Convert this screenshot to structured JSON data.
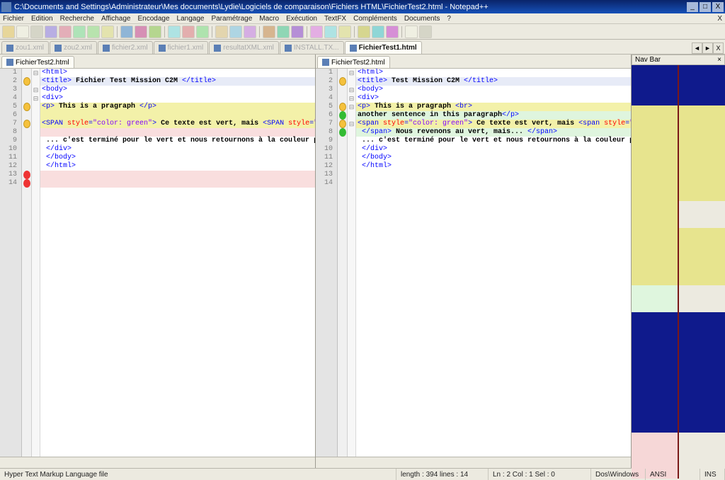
{
  "window": {
    "title": "C:\\Documents and Settings\\Administrateur\\Mes documents\\Lydie\\Logiciels de comparaison\\Fichiers HTML\\FichierTest2.html - Notepad++",
    "btn_min": "_",
    "btn_max": "□",
    "btn_close": "X"
  },
  "menu": {
    "items": [
      "Fichier",
      "Edition",
      "Recherche",
      "Affichage",
      "Encodage",
      "Langage",
      "Paramétrage",
      "Macro",
      "Exécution",
      "TextFX",
      "Compléments",
      "Documents",
      "?"
    ],
    "close_x": "X"
  },
  "tabs": {
    "items": [
      {
        "label": "zou1.xml",
        "state": "disabled"
      },
      {
        "label": "zou2.xml",
        "state": "disabled"
      },
      {
        "label": "fichier2.xml",
        "state": "disabled"
      },
      {
        "label": "fichier1.xml",
        "state": "disabled"
      },
      {
        "label": "resultatXML.xml",
        "state": "disabled"
      },
      {
        "label": "INSTALL.TX...",
        "state": "disabled"
      },
      {
        "label": "FichierTest1.html",
        "state": "active"
      }
    ],
    "nav_left": "◄",
    "nav_right": "►",
    "nav_x": "X"
  },
  "left_pane": {
    "tab": "FichierTest2.html",
    "lines": [
      {
        "n": 1,
        "mark": "",
        "fold": "⊟",
        "hl": "",
        "tokens": [
          [
            "t",
            "<html>"
          ]
        ]
      },
      {
        "n": 2,
        "mark": "warn",
        "fold": "",
        "hl": "b",
        "tokens": [
          [
            "t",
            "<title>"
          ],
          [
            "b",
            " Fichier Test Mission C2M "
          ],
          [
            "t",
            "</title>"
          ]
        ]
      },
      {
        "n": 3,
        "mark": "",
        "fold": "⊟",
        "hl": "",
        "tokens": [
          [
            "t",
            "<body>"
          ]
        ]
      },
      {
        "n": 4,
        "mark": "",
        "fold": "⊟",
        "hl": "",
        "tokens": [
          [
            "t",
            "<div>"
          ]
        ]
      },
      {
        "n": 5,
        "mark": "warn",
        "fold": "",
        "hl": "y",
        "tokens": [
          [
            "t",
            "<p>"
          ],
          [
            "b",
            " This is a pragraph "
          ],
          [
            "t",
            "</p>"
          ]
        ]
      },
      {
        "n": 6,
        "mark": "",
        "fold": "",
        "hl": "y",
        "tokens": [
          [
            "",
            ""
          ]
        ]
      },
      {
        "n": 7,
        "mark": "warn",
        "fold": "",
        "hl": "y",
        "tokens": [
          [
            "t",
            "<SPAN "
          ],
          [
            "a",
            "style"
          ],
          [
            "t",
            "="
          ],
          [
            "v",
            "\"color: green\""
          ],
          [
            "t",
            ">"
          ],
          [
            "b",
            " Ce texte est vert, mais "
          ],
          [
            "t",
            "<SPAN "
          ],
          [
            "a",
            "style"
          ],
          [
            "t",
            "="
          ],
          [
            "v",
            "\"color: red\""
          ]
        ]
      },
      {
        "n": 8,
        "mark": "",
        "fold": "",
        "hl": "p",
        "tokens": [
          [
            "",
            ""
          ]
        ]
      },
      {
        "n": 9,
        "mark": "",
        "fold": "",
        "hl": "",
        "tokens": [
          [
            "b",
            " ... c'est terminé pour le vert et nous retournons à la couleur par défaut de"
          ]
        ]
      },
      {
        "n": 10,
        "mark": "",
        "fold": "",
        "hl": "",
        "tokens": [
          [
            "t",
            " </div>"
          ]
        ]
      },
      {
        "n": 11,
        "mark": "",
        "fold": "",
        "hl": "",
        "tokens": [
          [
            "t",
            " </body>"
          ]
        ]
      },
      {
        "n": 12,
        "mark": "",
        "fold": "",
        "hl": "",
        "tokens": [
          [
            "t",
            " </html>"
          ]
        ]
      },
      {
        "n": 13,
        "mark": "err",
        "fold": "",
        "hl": "p",
        "tokens": [
          [
            "",
            ""
          ]
        ]
      },
      {
        "n": 14,
        "mark": "err",
        "fold": "",
        "hl": "p",
        "tokens": [
          [
            "",
            ""
          ]
        ]
      }
    ]
  },
  "right_pane": {
    "tab": "FichierTest2.html",
    "lines": [
      {
        "n": 1,
        "mark": "",
        "fold": "⊟",
        "hl": "",
        "tokens": [
          [
            "t",
            "<html>"
          ]
        ]
      },
      {
        "n": 2,
        "mark": "warn",
        "fold": "",
        "hl": "b",
        "tokens": [
          [
            "t",
            "<title>"
          ],
          [
            "b",
            " Test Mission C2M "
          ],
          [
            "t",
            "</title>"
          ]
        ]
      },
      {
        "n": 3,
        "mark": "",
        "fold": "⊟",
        "hl": "",
        "tokens": [
          [
            "t",
            "<body>"
          ]
        ]
      },
      {
        "n": 4,
        "mark": "",
        "fold": "⊟",
        "hl": "",
        "tokens": [
          [
            "t",
            "<div>"
          ]
        ]
      },
      {
        "n": 5,
        "mark": "warn",
        "fold": "⊟",
        "hl": "y",
        "tokens": [
          [
            "t",
            "<p>"
          ],
          [
            "b",
            " This is a pragraph "
          ],
          [
            "t",
            "<br>"
          ]
        ]
      },
      {
        "n": 6,
        "mark": "ok",
        "fold": "",
        "hl": "g",
        "tokens": [
          [
            "b",
            "another sentence in this paragraph"
          ],
          [
            "t",
            "</p>"
          ]
        ]
      },
      {
        "n": 7,
        "mark": "warn",
        "fold": "⊟",
        "hl": "y",
        "tokens": [
          [
            "t",
            "<span "
          ],
          [
            "a",
            "style"
          ],
          [
            "t",
            "="
          ],
          [
            "v",
            "\"color: green\""
          ],
          [
            "t",
            ">"
          ],
          [
            "b",
            " Ce texte est vert, mais "
          ],
          [
            "t",
            "<span "
          ],
          [
            "a",
            "style"
          ],
          [
            "t",
            "="
          ],
          [
            "v",
            "\"color: red"
          ]
        ]
      },
      {
        "n": 8,
        "mark": "ok",
        "fold": "",
        "hl": "g",
        "tokens": [
          [
            "t",
            " </span>"
          ],
          [
            "b",
            " Nous revenons au vert, mais... "
          ],
          [
            "t",
            "</span>"
          ]
        ]
      },
      {
        "n": 9,
        "mark": "",
        "fold": "",
        "hl": "",
        "tokens": [
          [
            "b",
            " ... c'est terminé pour le vert et nous retournons à la couleur par défaut d"
          ]
        ]
      },
      {
        "n": 10,
        "mark": "",
        "fold": "",
        "hl": "",
        "tokens": [
          [
            "t",
            " </div>"
          ]
        ]
      },
      {
        "n": 11,
        "mark": "",
        "fold": "",
        "hl": "",
        "tokens": [
          [
            "t",
            " </body>"
          ]
        ]
      },
      {
        "n": 12,
        "mark": "",
        "fold": "",
        "hl": "",
        "tokens": [
          [
            "t",
            " </html>"
          ]
        ]
      },
      {
        "n": 13,
        "mark": "",
        "fold": "",
        "hl": "",
        "tokens": [
          [
            "",
            ""
          ]
        ]
      },
      {
        "n": 14,
        "mark": "",
        "fold": "",
        "hl": "",
        "tokens": [
          [
            "",
            ""
          ]
        ]
      }
    ]
  },
  "navbar": {
    "title": "Nav Bar",
    "close": "×",
    "left_blocks": [
      {
        "c": "#0f1a8c",
        "h": 57
      },
      {
        "c": "#e7e48e",
        "h": 135
      },
      {
        "c": "#e7e48e",
        "h": 38
      },
      {
        "c": "#e7e48e",
        "h": 18
      },
      {
        "c": "#e7e48e",
        "h": 63
      },
      {
        "c": "#dff6de",
        "h": 38
      },
      {
        "c": "#0f1a8c",
        "h": 170
      },
      {
        "c": "#f6d7d7",
        "h": 65
      }
    ],
    "right_blocks": [
      {
        "c": "#0f1a8c",
        "h": 57
      },
      {
        "c": "#e7e48e",
        "h": 135
      },
      {
        "c": "#eceae0",
        "h": 38
      },
      {
        "c": "#e7e48e",
        "h": 18
      },
      {
        "c": "#e7e48e",
        "h": 63
      },
      {
        "c": "#eceae0",
        "h": 38
      },
      {
        "c": "#0f1a8c",
        "h": 170
      },
      {
        "c": "#eceae0",
        "h": 65
      }
    ]
  },
  "status": {
    "filetype": "Hyper Text Markup Language file",
    "length": "length : 394   lines : 14",
    "pos": "Ln : 2   Col : 1   Sel : 0",
    "eol": "Dos\\Windows",
    "enc": "ANSI",
    "mode": "INS"
  },
  "toolbar_colors": [
    "#e7d69a",
    "#efefe2",
    "#d5d5c7",
    "#b8aee3",
    "#e3aeb8",
    "#aee3b8",
    "#b8e3ae",
    "#e3e3ae",
    "#c7c7c7",
    "#8fb5d6",
    "#d68fb5",
    "#b5d68f",
    "#c7c7c7",
    "#aee3e3",
    "#e3aeae",
    "#aee3ae",
    "#c7c7c7",
    "#e3d5ae",
    "#aed5e3",
    "#d5aee3",
    "#c7c7c7",
    "#d6b58f",
    "#8fd6b5",
    "#b58fd6",
    "#c7c7c7",
    "#e3aee3",
    "#aee3e3",
    "#e3e3ae",
    "#c7c7c7",
    "#d6d68f",
    "#8fd6d6",
    "#d68fd6",
    "#c7c7c7",
    "#efefe2",
    "#d5d5c7"
  ]
}
